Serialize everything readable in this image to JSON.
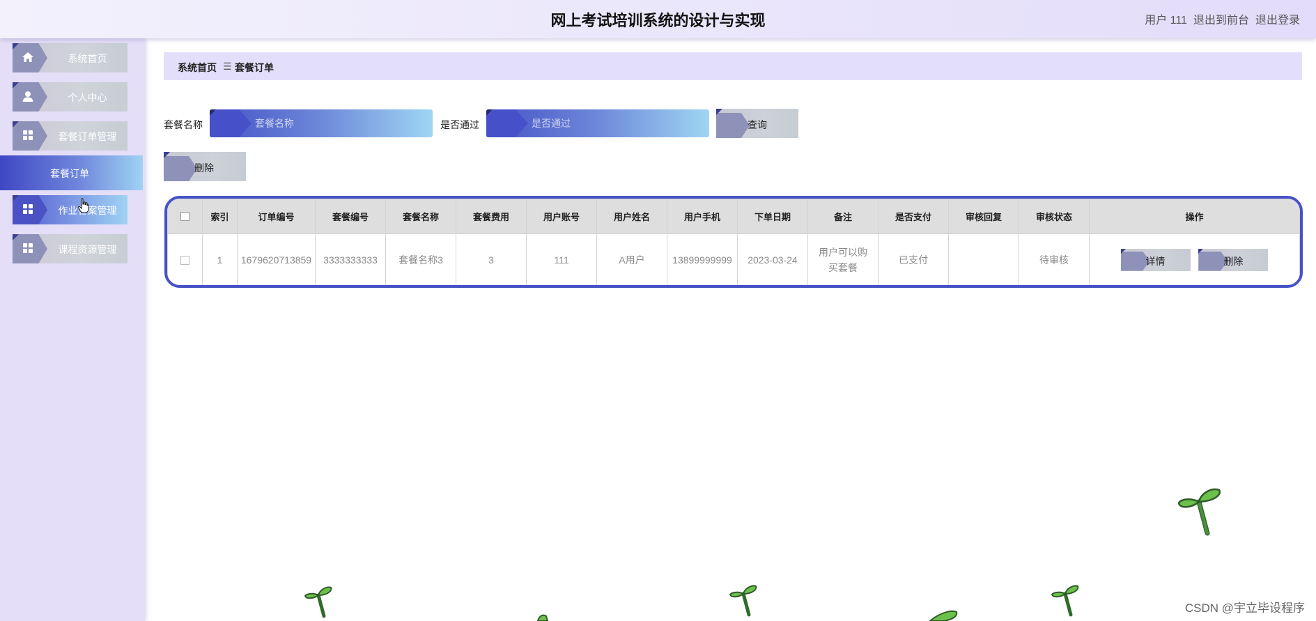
{
  "app": {
    "title": "网上考试培训系统的设计与实现"
  },
  "header": {
    "user_label": "用户 111",
    "exit_front_label": "退出到前台",
    "logout_label": "退出登录"
  },
  "sidebar": {
    "items": [
      {
        "label": "系统首页",
        "icon": "home-icon"
      },
      {
        "label": "个人中心",
        "icon": "user-icon"
      },
      {
        "label": "套餐订单管理",
        "icon": "grid-icon"
      },
      {
        "label": "作业答案管理",
        "icon": "grid-icon"
      },
      {
        "label": "课程资源管理",
        "icon": "grid-icon"
      }
    ],
    "submenu": {
      "label": "套餐订单"
    }
  },
  "breadcrumb": {
    "home": "系统首页",
    "separator": "☰",
    "current": "套餐订单"
  },
  "search": {
    "package_name_label": "套餐名称",
    "package_name_placeholder": "套餐名称",
    "passed_label": "是否通过",
    "passed_placeholder": "是否通过",
    "query_label": "查询"
  },
  "toolbar": {
    "delete_label": "删除"
  },
  "table": {
    "headers": [
      "索引",
      "订单编号",
      "套餐编号",
      "套餐名称",
      "套餐费用",
      "用户账号",
      "用户姓名",
      "用户手机",
      "下单日期",
      "备注",
      "是否支付",
      "审核回复",
      "审核状态",
      "操作"
    ],
    "rows": [
      {
        "index": "1",
        "order_no": "1679620713859",
        "package_no": "3333333333",
        "package_name": "套餐名称3",
        "package_fee": "3",
        "user_account": "111",
        "user_name": "A用户",
        "user_phone": "13899999999",
        "order_date": "2023-03-24",
        "remark": "用户可以购买套餐",
        "paid": "已支付",
        "audit_reply": "",
        "audit_status": "待审核",
        "detail_label": "详情",
        "delete_label": "删除"
      }
    ]
  },
  "watermark": "CSDN @宇立毕设程序",
  "colors": {
    "accent": "#4652c6",
    "sidebar_bg": "#e4def9",
    "header_bg": "#ebe7fb",
    "propeller_green": "#6bc14a"
  }
}
